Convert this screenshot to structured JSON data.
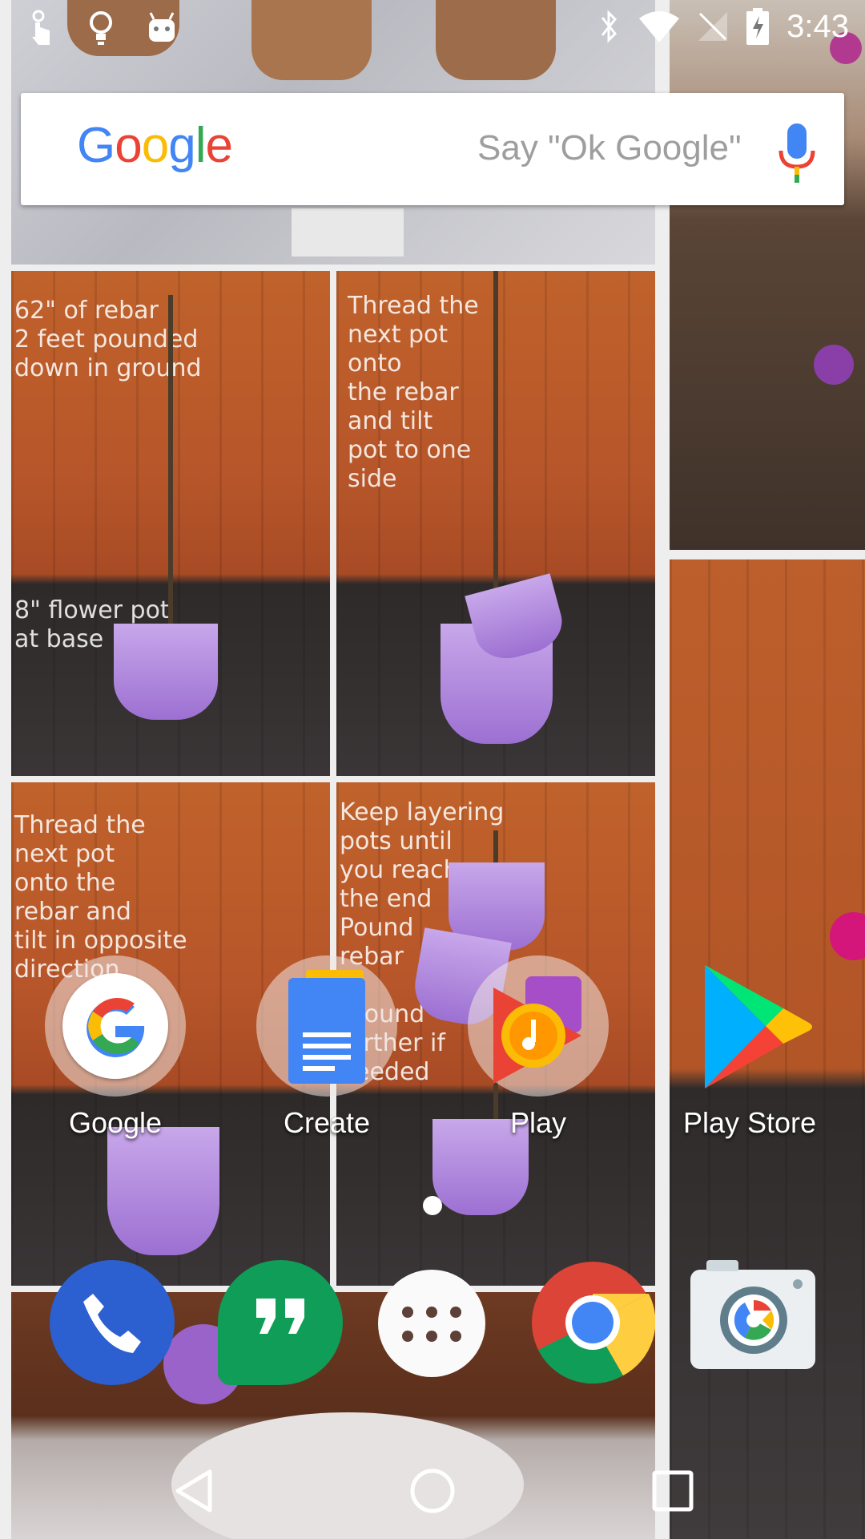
{
  "status_bar": {
    "time": "3:43",
    "left_icons": [
      "touch-icon",
      "lightbulb-icon",
      "android-icon"
    ],
    "right_icons": [
      "bluetooth-icon",
      "wifi-icon",
      "no-signal-icon",
      "battery-charging-icon"
    ]
  },
  "search": {
    "logo": "Google",
    "hint": "Say \"Ok Google\"",
    "mic_icon": "mic-icon"
  },
  "apps": [
    {
      "label": "Google",
      "icon": "google-folder-icon"
    },
    {
      "label": "Create",
      "icon": "docs-folder-icon"
    },
    {
      "label": "Play",
      "icon": "play-folder-icon"
    },
    {
      "label": "Play Store",
      "icon": "play-store-icon"
    }
  ],
  "dock": [
    {
      "name": "phone",
      "icon": "phone-icon"
    },
    {
      "name": "hangouts",
      "icon": "hangouts-icon"
    },
    {
      "name": "app-drawer",
      "icon": "app-drawer-icon"
    },
    {
      "name": "chrome",
      "icon": "chrome-icon"
    },
    {
      "name": "camera",
      "icon": "camera-icon"
    }
  ],
  "wallpaper": {
    "captions": [
      "62\" of rebar\n2 feet pounded\ndown in ground",
      "8\" flower pot\nat base",
      "Thread the\nnext pot\nonto\nthe rebar\nand tilt\npot to one\nside",
      "Thread the\nnext pot\nonto the\nrebar and\ntilt in opposite\ndirection",
      "Keep layering\npots until\nyou reach\nthe end\nPound\nrebar\nto\nground\nfurther if\nneeded"
    ]
  },
  "navigation": {
    "icons": [
      "back-icon",
      "home-icon",
      "recents-icon"
    ]
  },
  "page_indicator": {
    "pages": 1,
    "current": 1
  },
  "colors": {
    "google_blue": "#4285F4",
    "google_red": "#EA4335",
    "google_yellow": "#FBBC05",
    "google_green": "#34A853"
  }
}
